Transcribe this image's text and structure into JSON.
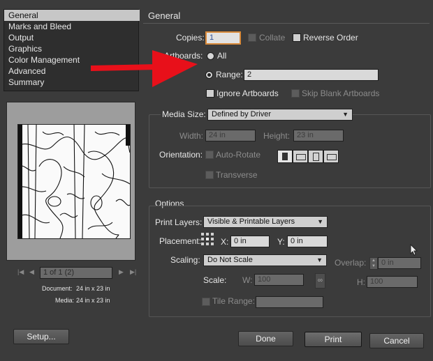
{
  "nav": {
    "items": [
      {
        "label": "General",
        "selected": true
      },
      {
        "label": "Marks and Bleed"
      },
      {
        "label": "Output"
      },
      {
        "label": "Graphics"
      },
      {
        "label": "Color Management"
      },
      {
        "label": "Advanced"
      },
      {
        "label": "Summary"
      }
    ]
  },
  "preview": {
    "page_indicator": "1 of 1 (2)",
    "document_label": "Document:",
    "document_value": "24 in x 23 in",
    "media_label": "Media:",
    "media_value": "24 in x 23 in"
  },
  "general": {
    "title": "General",
    "copies_label": "Copies:",
    "copies_value": "1",
    "collate_label": "Collate",
    "reverse_order_label": "Reverse Order",
    "artboards_label": "Artboards:",
    "all_label": "All",
    "range_label": "Range:",
    "range_value": "2",
    "ignore_artboards_label": "Ignore Artboards",
    "skip_blank_label": "Skip Blank Artboards"
  },
  "media": {
    "size_label": "Media Size:",
    "size_value": "Defined by Driver",
    "width_label": "Width:",
    "width_value": "24 in",
    "height_label": "Height:",
    "height_value": "23 in",
    "orientation_label": "Orientation:",
    "auto_rotate_label": "Auto-Rotate",
    "transverse_label": "Transverse"
  },
  "options": {
    "title": "Options",
    "print_layers_label": "Print Layers:",
    "print_layers_value": "Visible & Printable Layers",
    "placement_label": "Placement:",
    "x_label": "X:",
    "x_value": "0 in",
    "y_label": "Y:",
    "y_value": "0 in",
    "scaling_label": "Scaling:",
    "scaling_value": "Do Not Scale",
    "overlap_label": "Overlap:",
    "overlap_value": "0 in",
    "scale_label": "Scale:",
    "w_label": "W:",
    "w_value": "100",
    "h_label": "H:",
    "h_value": "100",
    "tile_range_label": "Tile Range:"
  },
  "buttons": {
    "setup": "Setup...",
    "done": "Done",
    "print": "Print",
    "cancel": "Cancel"
  },
  "colors": {
    "background": "#3b3b3b",
    "arrow": "#e8101a"
  }
}
